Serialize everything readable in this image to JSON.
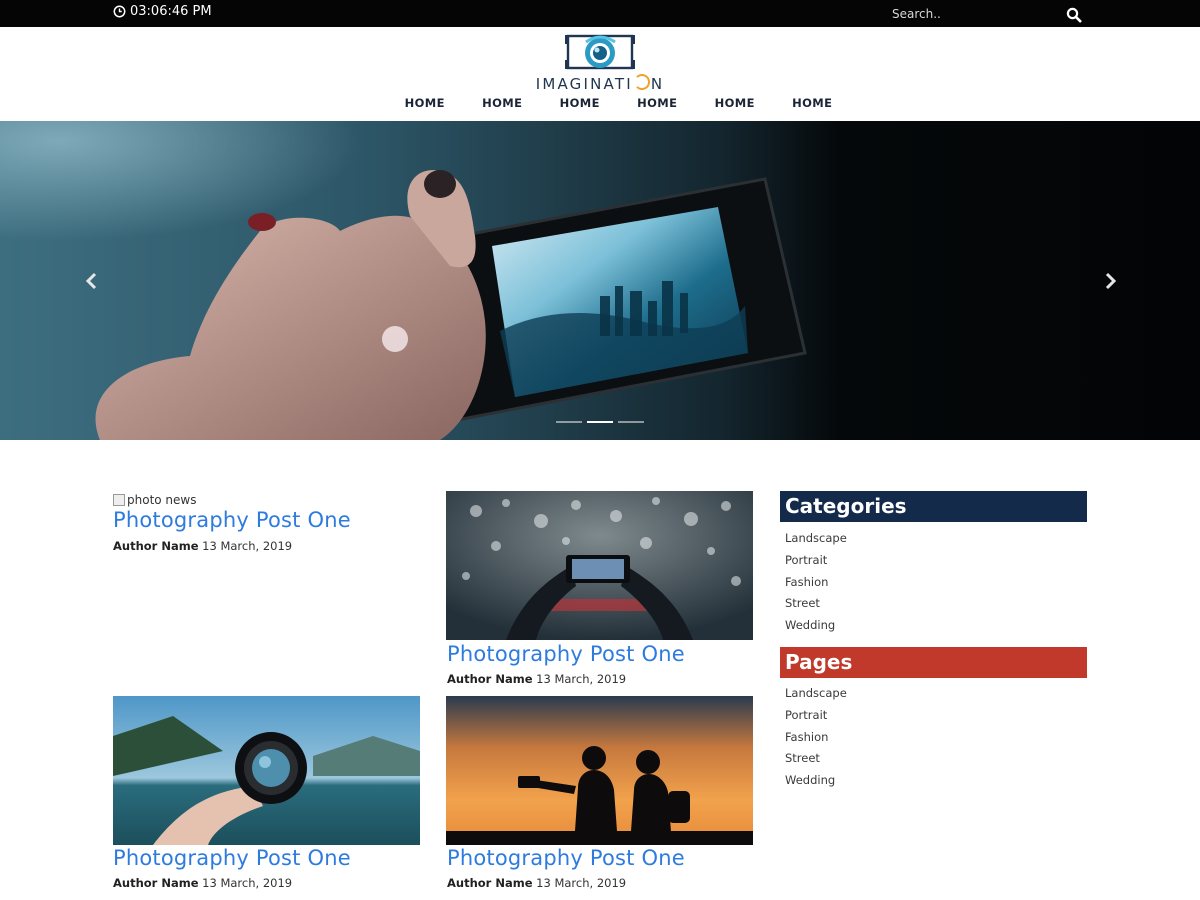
{
  "topbar": {
    "time": "03:06:46 PM",
    "search_placeholder": "Search..",
    "icons": {
      "clock": "clock-icon",
      "search": "search-icon"
    }
  },
  "header": {
    "logo_text_a": "IMAGINATI",
    "logo_text_b": "N",
    "nav": [
      "HOME",
      "HOME",
      "HOME",
      "HOME",
      "HOME",
      "HOME"
    ]
  },
  "slider": {
    "slide_count": 3,
    "active_index": 1
  },
  "posts": [
    {
      "image_alt": "photo news",
      "title": "Photography Post One",
      "author": "Author Name",
      "date": "13 March, 2019"
    },
    {
      "title": "Photography Post One",
      "author": "Author Name",
      "date": "13 March, 2019"
    },
    {
      "title": "Photography Post One",
      "author": "Author Name",
      "date": "13 March, 2019"
    },
    {
      "title": "Photography Post One",
      "author": "Author Name",
      "date": "13 March, 2019"
    }
  ],
  "sidebar": {
    "categories": {
      "title": "Categories",
      "color": "#132a4a",
      "items": [
        "Landscape",
        "Portrait",
        "Fashion",
        "Street",
        "Wedding"
      ]
    },
    "pages": {
      "title": "Pages",
      "color": "#c0392b",
      "items": [
        "Landscape",
        "Portrait",
        "Fashion",
        "Street",
        "Wedding"
      ]
    }
  },
  "colors": {
    "link": "#2e7be0",
    "topbar": "#050505",
    "nav_text": "#1b2436"
  }
}
